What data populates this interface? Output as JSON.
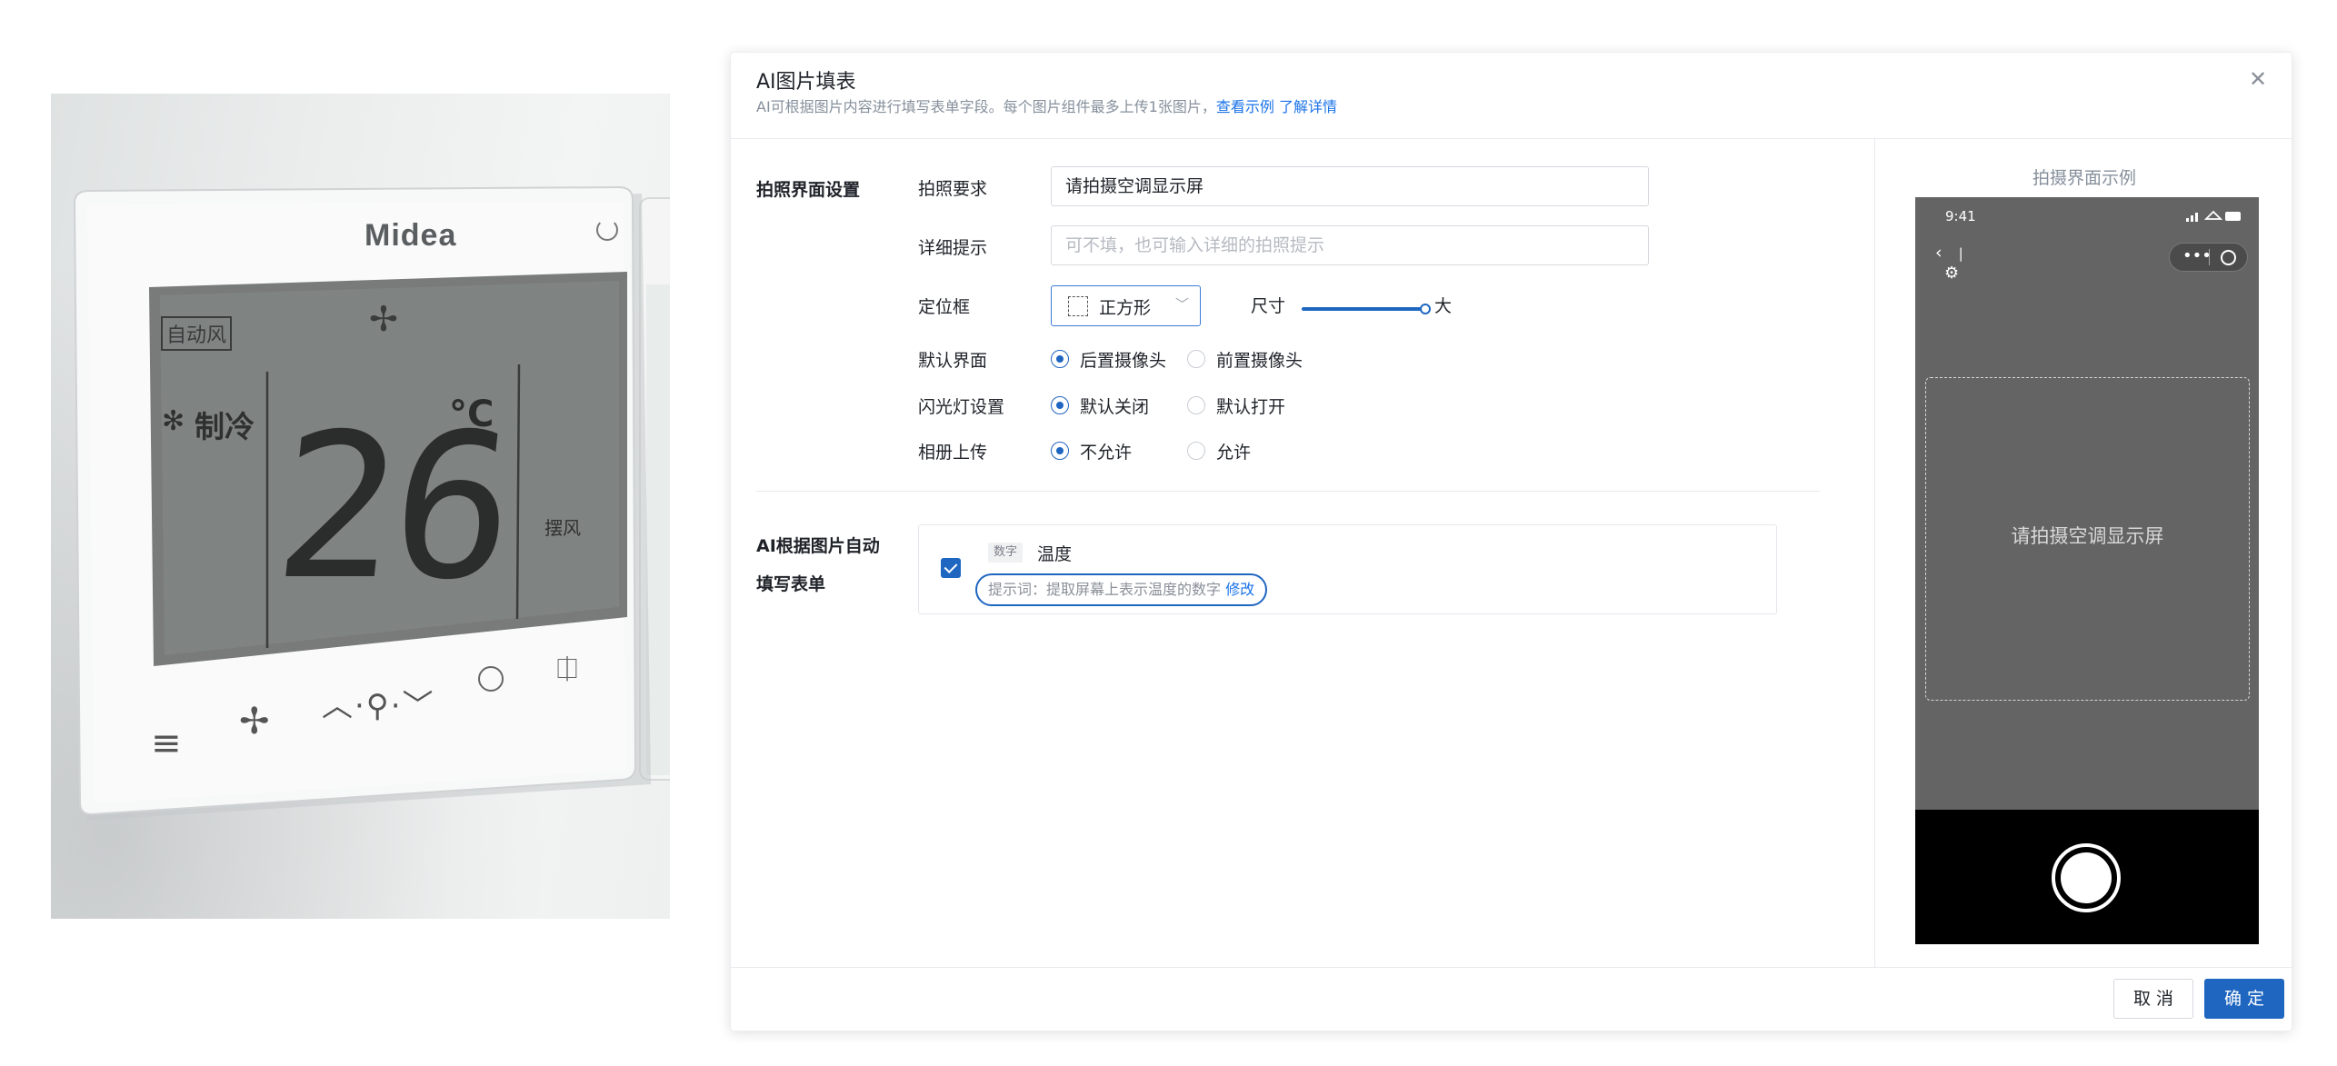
{
  "photo": {
    "brand": "Midea",
    "mode_badge": "自动风",
    "mode": "制冷",
    "temperature": "26",
    "unit": "°C",
    "swing": "摆风"
  },
  "dialog": {
    "title": "AI图片填表",
    "subtitle": "AI可根据图片内容进行填写表单字段。每个图片组件最多上传1张图片，",
    "link_example": "查看示例",
    "link_detail": "了解详情",
    "close_icon": "close-icon"
  },
  "capture_settings": {
    "section_title": "拍照界面设置",
    "requirement_label": "拍照要求",
    "requirement_value": "请拍摄空调显示屏",
    "detail_label": "详细提示",
    "detail_placeholder": "可不填，也可输入详细的拍照提示",
    "frame_label": "定位框",
    "frame_value": "正方形",
    "size_label": "尺寸",
    "size_value_label": "大",
    "size_level": 1.0,
    "default_view_label": "默认界面",
    "default_view_options": [
      "后置摄像头",
      "前置摄像头"
    ],
    "default_view_selected": 0,
    "flash_label": "闪光灯设置",
    "flash_options": [
      "默认关闭",
      "默认打开"
    ],
    "flash_selected": 0,
    "album_label": "相册上传",
    "album_options": [
      "不允许",
      "允许"
    ],
    "album_selected": 0
  },
  "ai_fill": {
    "section_title_line1": "AI根据图片自动",
    "section_title_line2": "填写表单",
    "field": {
      "checked": true,
      "type_tag": "数字",
      "name": "温度",
      "hint": "提示词：提取屏幕上表示温度的数字",
      "edit_label": "修改"
    }
  },
  "preview": {
    "title": "拍摄界面示例",
    "time": "9:41",
    "frame_text": "请拍摄空调显示屏"
  },
  "footer": {
    "cancel_label": "取 消",
    "confirm_label": "确 定"
  },
  "colors": {
    "accent": "#1f66c1",
    "link": "#1a73e8",
    "phone_bg": "#646464"
  }
}
